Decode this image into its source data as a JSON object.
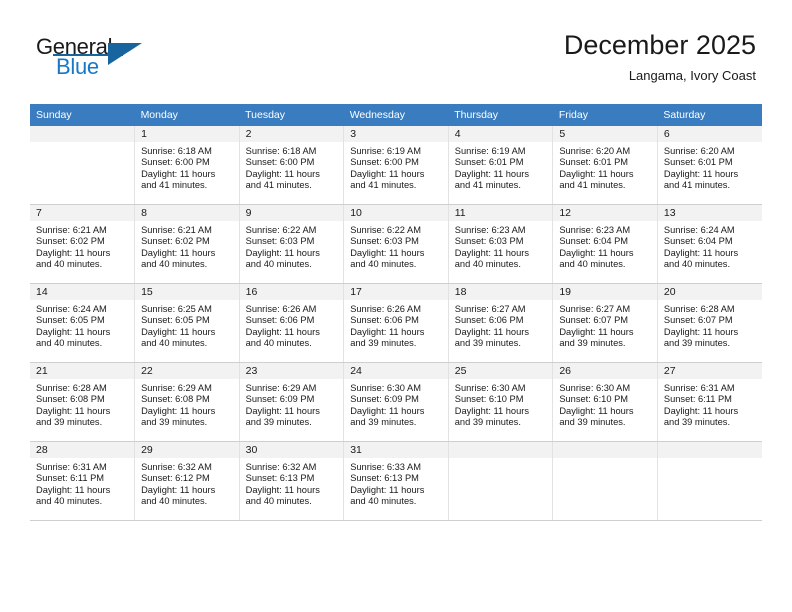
{
  "brand": {
    "word_one": "General",
    "word_two": "Blue",
    "logo_icon": "triangle-logo-icon",
    "accent_color": "#1878c8",
    "triangle_color": "#18649e"
  },
  "header": {
    "title": "December 2025",
    "subtitle": "Langama, Ivory Coast"
  },
  "calendar": {
    "header_bg": "#3a7cc0",
    "header_text_color": "#ffffff",
    "daynum_bg": "#f2f2f2",
    "weekday_headers": [
      "Sunday",
      "Monday",
      "Tuesday",
      "Wednesday",
      "Thursday",
      "Friday",
      "Saturday"
    ],
    "weeks": [
      [
        {
          "day": "",
          "sunrise": "",
          "sunset": "",
          "daylight_line1": "",
          "daylight_line2": "",
          "empty": true
        },
        {
          "day": "1",
          "sunrise": "Sunrise: 6:18 AM",
          "sunset": "Sunset: 6:00 PM",
          "daylight_line1": "Daylight: 11 hours",
          "daylight_line2": "and 41 minutes."
        },
        {
          "day": "2",
          "sunrise": "Sunrise: 6:18 AM",
          "sunset": "Sunset: 6:00 PM",
          "daylight_line1": "Daylight: 11 hours",
          "daylight_line2": "and 41 minutes."
        },
        {
          "day": "3",
          "sunrise": "Sunrise: 6:19 AM",
          "sunset": "Sunset: 6:00 PM",
          "daylight_line1": "Daylight: 11 hours",
          "daylight_line2": "and 41 minutes."
        },
        {
          "day": "4",
          "sunrise": "Sunrise: 6:19 AM",
          "sunset": "Sunset: 6:01 PM",
          "daylight_line1": "Daylight: 11 hours",
          "daylight_line2": "and 41 minutes."
        },
        {
          "day": "5",
          "sunrise": "Sunrise: 6:20 AM",
          "sunset": "Sunset: 6:01 PM",
          "daylight_line1": "Daylight: 11 hours",
          "daylight_line2": "and 41 minutes."
        },
        {
          "day": "6",
          "sunrise": "Sunrise: 6:20 AM",
          "sunset": "Sunset: 6:01 PM",
          "daylight_line1": "Daylight: 11 hours",
          "daylight_line2": "and 41 minutes."
        }
      ],
      [
        {
          "day": "7",
          "sunrise": "Sunrise: 6:21 AM",
          "sunset": "Sunset: 6:02 PM",
          "daylight_line1": "Daylight: 11 hours",
          "daylight_line2": "and 40 minutes."
        },
        {
          "day": "8",
          "sunrise": "Sunrise: 6:21 AM",
          "sunset": "Sunset: 6:02 PM",
          "daylight_line1": "Daylight: 11 hours",
          "daylight_line2": "and 40 minutes."
        },
        {
          "day": "9",
          "sunrise": "Sunrise: 6:22 AM",
          "sunset": "Sunset: 6:03 PM",
          "daylight_line1": "Daylight: 11 hours",
          "daylight_line2": "and 40 minutes."
        },
        {
          "day": "10",
          "sunrise": "Sunrise: 6:22 AM",
          "sunset": "Sunset: 6:03 PM",
          "daylight_line1": "Daylight: 11 hours",
          "daylight_line2": "and 40 minutes."
        },
        {
          "day": "11",
          "sunrise": "Sunrise: 6:23 AM",
          "sunset": "Sunset: 6:03 PM",
          "daylight_line1": "Daylight: 11 hours",
          "daylight_line2": "and 40 minutes."
        },
        {
          "day": "12",
          "sunrise": "Sunrise: 6:23 AM",
          "sunset": "Sunset: 6:04 PM",
          "daylight_line1": "Daylight: 11 hours",
          "daylight_line2": "and 40 minutes."
        },
        {
          "day": "13",
          "sunrise": "Sunrise: 6:24 AM",
          "sunset": "Sunset: 6:04 PM",
          "daylight_line1": "Daylight: 11 hours",
          "daylight_line2": "and 40 minutes."
        }
      ],
      [
        {
          "day": "14",
          "sunrise": "Sunrise: 6:24 AM",
          "sunset": "Sunset: 6:05 PM",
          "daylight_line1": "Daylight: 11 hours",
          "daylight_line2": "and 40 minutes."
        },
        {
          "day": "15",
          "sunrise": "Sunrise: 6:25 AM",
          "sunset": "Sunset: 6:05 PM",
          "daylight_line1": "Daylight: 11 hours",
          "daylight_line2": "and 40 minutes."
        },
        {
          "day": "16",
          "sunrise": "Sunrise: 6:26 AM",
          "sunset": "Sunset: 6:06 PM",
          "daylight_line1": "Daylight: 11 hours",
          "daylight_line2": "and 40 minutes."
        },
        {
          "day": "17",
          "sunrise": "Sunrise: 6:26 AM",
          "sunset": "Sunset: 6:06 PM",
          "daylight_line1": "Daylight: 11 hours",
          "daylight_line2": "and 39 minutes."
        },
        {
          "day": "18",
          "sunrise": "Sunrise: 6:27 AM",
          "sunset": "Sunset: 6:06 PM",
          "daylight_line1": "Daylight: 11 hours",
          "daylight_line2": "and 39 minutes."
        },
        {
          "day": "19",
          "sunrise": "Sunrise: 6:27 AM",
          "sunset": "Sunset: 6:07 PM",
          "daylight_line1": "Daylight: 11 hours",
          "daylight_line2": "and 39 minutes."
        },
        {
          "day": "20",
          "sunrise": "Sunrise: 6:28 AM",
          "sunset": "Sunset: 6:07 PM",
          "daylight_line1": "Daylight: 11 hours",
          "daylight_line2": "and 39 minutes."
        }
      ],
      [
        {
          "day": "21",
          "sunrise": "Sunrise: 6:28 AM",
          "sunset": "Sunset: 6:08 PM",
          "daylight_line1": "Daylight: 11 hours",
          "daylight_line2": "and 39 minutes."
        },
        {
          "day": "22",
          "sunrise": "Sunrise: 6:29 AM",
          "sunset": "Sunset: 6:08 PM",
          "daylight_line1": "Daylight: 11 hours",
          "daylight_line2": "and 39 minutes."
        },
        {
          "day": "23",
          "sunrise": "Sunrise: 6:29 AM",
          "sunset": "Sunset: 6:09 PM",
          "daylight_line1": "Daylight: 11 hours",
          "daylight_line2": "and 39 minutes."
        },
        {
          "day": "24",
          "sunrise": "Sunrise: 6:30 AM",
          "sunset": "Sunset: 6:09 PM",
          "daylight_line1": "Daylight: 11 hours",
          "daylight_line2": "and 39 minutes."
        },
        {
          "day": "25",
          "sunrise": "Sunrise: 6:30 AM",
          "sunset": "Sunset: 6:10 PM",
          "daylight_line1": "Daylight: 11 hours",
          "daylight_line2": "and 39 minutes."
        },
        {
          "day": "26",
          "sunrise": "Sunrise: 6:30 AM",
          "sunset": "Sunset: 6:10 PM",
          "daylight_line1": "Daylight: 11 hours",
          "daylight_line2": "and 39 minutes."
        },
        {
          "day": "27",
          "sunrise": "Sunrise: 6:31 AM",
          "sunset": "Sunset: 6:11 PM",
          "daylight_line1": "Daylight: 11 hours",
          "daylight_line2": "and 39 minutes."
        }
      ],
      [
        {
          "day": "28",
          "sunrise": "Sunrise: 6:31 AM",
          "sunset": "Sunset: 6:11 PM",
          "daylight_line1": "Daylight: 11 hours",
          "daylight_line2": "and 40 minutes."
        },
        {
          "day": "29",
          "sunrise": "Sunrise: 6:32 AM",
          "sunset": "Sunset: 6:12 PM",
          "daylight_line1": "Daylight: 11 hours",
          "daylight_line2": "and 40 minutes."
        },
        {
          "day": "30",
          "sunrise": "Sunrise: 6:32 AM",
          "sunset": "Sunset: 6:13 PM",
          "daylight_line1": "Daylight: 11 hours",
          "daylight_line2": "and 40 minutes."
        },
        {
          "day": "31",
          "sunrise": "Sunrise: 6:33 AM",
          "sunset": "Sunset: 6:13 PM",
          "daylight_line1": "Daylight: 11 hours",
          "daylight_line2": "and 40 minutes."
        },
        {
          "day": "",
          "sunrise": "",
          "sunset": "",
          "daylight_line1": "",
          "daylight_line2": "",
          "empty": true
        },
        {
          "day": "",
          "sunrise": "",
          "sunset": "",
          "daylight_line1": "",
          "daylight_line2": "",
          "empty": true
        },
        {
          "day": "",
          "sunrise": "",
          "sunset": "",
          "daylight_line1": "",
          "daylight_line2": "",
          "empty": true
        }
      ]
    ]
  }
}
